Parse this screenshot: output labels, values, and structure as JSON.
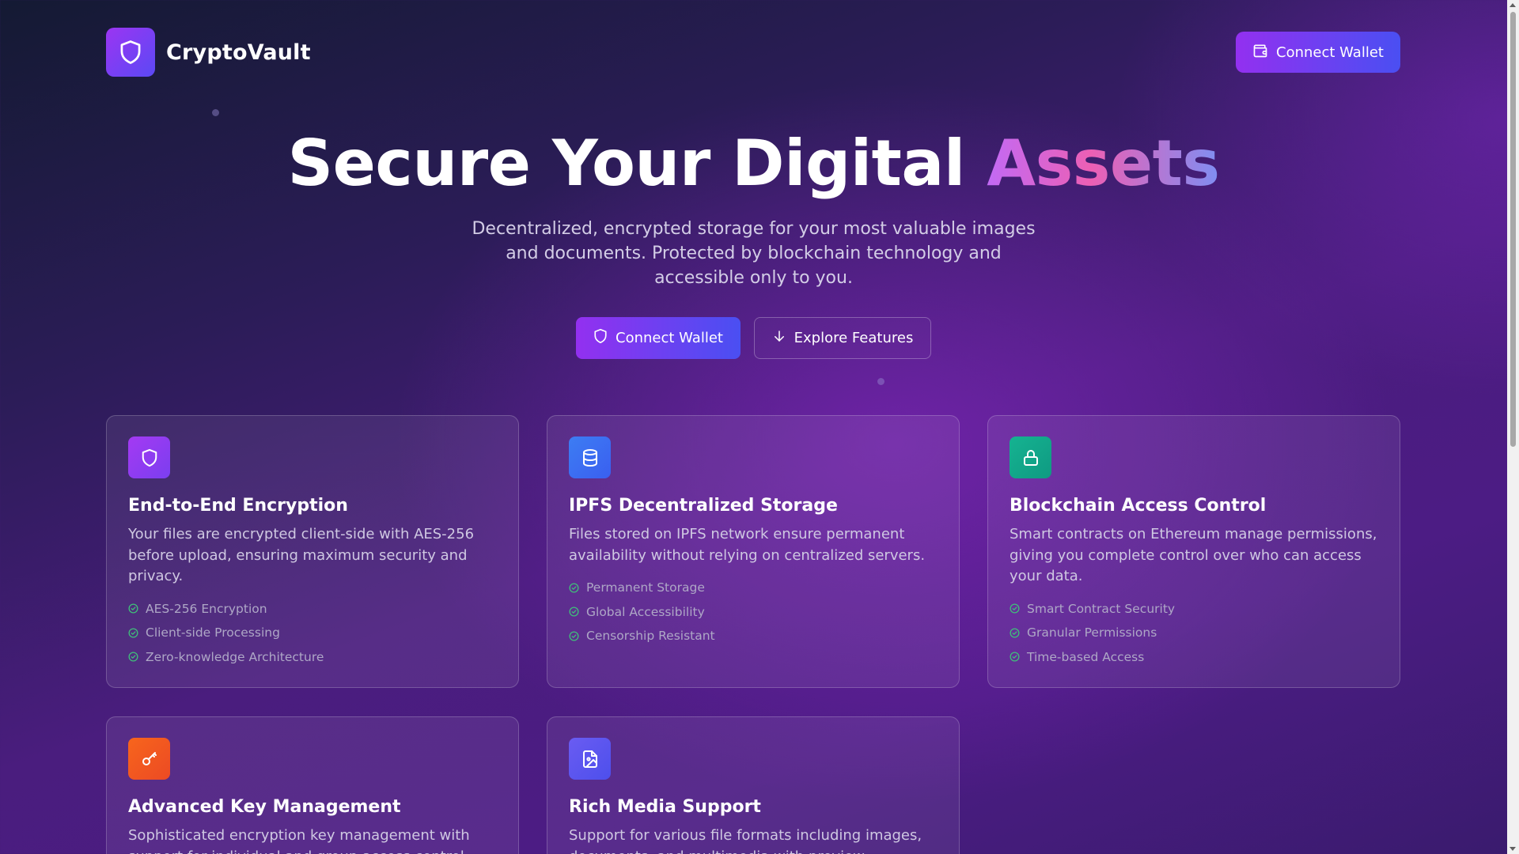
{
  "header": {
    "brand_name": "CryptoVault",
    "logo_icon": "shield-icon",
    "connect_wallet_label": "Connect Wallet",
    "connect_wallet_icon": "wallet-icon"
  },
  "hero": {
    "title_main": "Secure Your Digital ",
    "title_accent": "Assets",
    "subtitle": "Decentralized, encrypted storage for your most valuable images and documents. Protected by blockchain technology and accessible only to you.",
    "primary_button": "Connect Wallet",
    "primary_icon": "shield-icon",
    "secondary_button": "Explore Features",
    "secondary_icon": "arrow-down-icon"
  },
  "colors": {
    "accent_gradient_start": "#9330f0",
    "accent_gradient_end": "#4a4ff2",
    "check_green": "#3fbf7a"
  },
  "cards": [
    {
      "icon": "shield-icon",
      "icon_color": "#9b35f2",
      "title": "End-to-End Encryption",
      "description": "Your files are encrypted client-side with AES-256 before upload, ensuring maximum security and privacy.",
      "features": [
        "AES-256 Encryption",
        "Client-side Processing",
        "Zero-knowledge Architecture"
      ]
    },
    {
      "icon": "database-icon",
      "icon_color": "#3b72f2",
      "title": "IPFS Decentralized Storage",
      "description": "Files stored on IPFS network ensure permanent availability without relying on centralized servers.",
      "features": [
        "Permanent Storage",
        "Global Accessibility",
        "Censorship Resistant"
      ]
    },
    {
      "icon": "lock-icon",
      "icon_color": "#14a98a",
      "title": "Blockchain Access Control",
      "description": "Smart contracts on Ethereum manage permissions, giving you complete control over who can access your data.",
      "features": [
        "Smart Contract Security",
        "Granular Permissions",
        "Time-based Access"
      ]
    },
    {
      "icon": "key-icon",
      "icon_color": "#f0581f",
      "title": "Advanced Key Management",
      "description": "Sophisticated encryption key management with support for individual and group access control.",
      "features": []
    },
    {
      "icon": "image-file-icon",
      "icon_color": "#5b57ee",
      "title": "Rich Media Support",
      "description": "Support for various file formats including images, documents, and multimedia with preview capabilities.",
      "features": []
    }
  ]
}
